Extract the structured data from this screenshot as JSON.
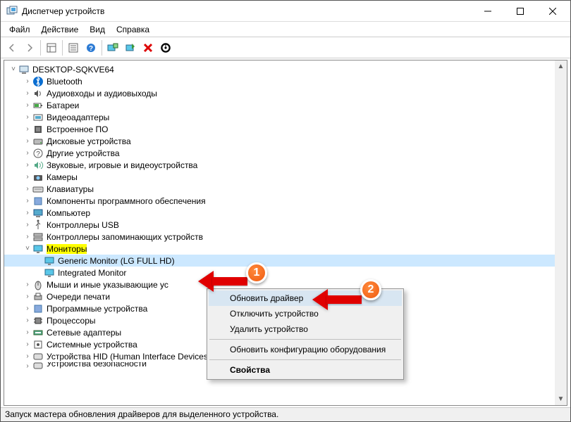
{
  "window": {
    "title": "Диспетчер устройств"
  },
  "menu": {
    "file": "Файл",
    "action": "Действие",
    "view": "Вид",
    "help": "Справка"
  },
  "tree": {
    "root": "DESKTOP-SQKVE64",
    "items": [
      "Bluetooth",
      "Аудиовходы и аудиовыходы",
      "Батареи",
      "Видеоадаптеры",
      "Встроенное ПО",
      "Дисковые устройства",
      "Другие устройства",
      "Звуковые, игровые и видеоустройства",
      "Камеры",
      "Клавиатуры",
      "Компоненты программного обеспечения",
      "Компьютер",
      "Контроллеры USB",
      "Контроллеры запоминающих устройств"
    ],
    "monitors": "Мониторы",
    "monitor1": "Generic Monitor (LG FULL HD)",
    "monitor2": "Integrated Monitor",
    "items2": [
      "Мыши и иные указывающие ус",
      "Очереди печати",
      "Программные устройства",
      "Процессоры",
      "Сетевые адаптеры",
      "Системные устройства",
      "Устройства HID (Human Interface Devices)"
    ],
    "last": "Устройства безопасности"
  },
  "context": {
    "update": "Обновить драйвер",
    "disable": "Отключить устройство",
    "remove": "Удалить устройство",
    "scan": "Обновить конфигурацию оборудования",
    "properties": "Свойства"
  },
  "status": "Запуск мастера обновления драйверов для выделенного устройства.",
  "badges": {
    "one": "1",
    "two": "2"
  }
}
